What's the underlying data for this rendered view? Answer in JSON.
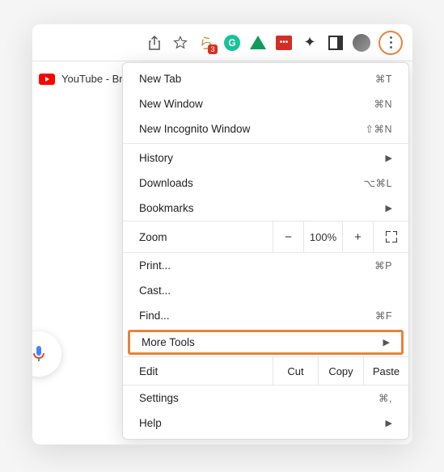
{
  "toolbar": {
    "badge_count": "3"
  },
  "tab": {
    "title": "YouTube - Br"
  },
  "menu": {
    "new_tab": "New Tab",
    "new_tab_sc": "⌘T",
    "new_window": "New Window",
    "new_window_sc": "⌘N",
    "incognito": "New Incognito Window",
    "incognito_sc": "⇧⌘N",
    "history": "History",
    "downloads": "Downloads",
    "downloads_sc": "⌥⌘L",
    "bookmarks": "Bookmarks",
    "zoom": "Zoom",
    "zoom_minus": "−",
    "zoom_value": "100%",
    "zoom_plus": "+",
    "print": "Print...",
    "print_sc": "⌘P",
    "cast": "Cast...",
    "find": "Find...",
    "find_sc": "⌘F",
    "more_tools": "More Tools",
    "edit": "Edit",
    "cut": "Cut",
    "copy": "Copy",
    "paste": "Paste",
    "settings": "Settings",
    "settings_sc": "⌘,",
    "help": "Help"
  }
}
